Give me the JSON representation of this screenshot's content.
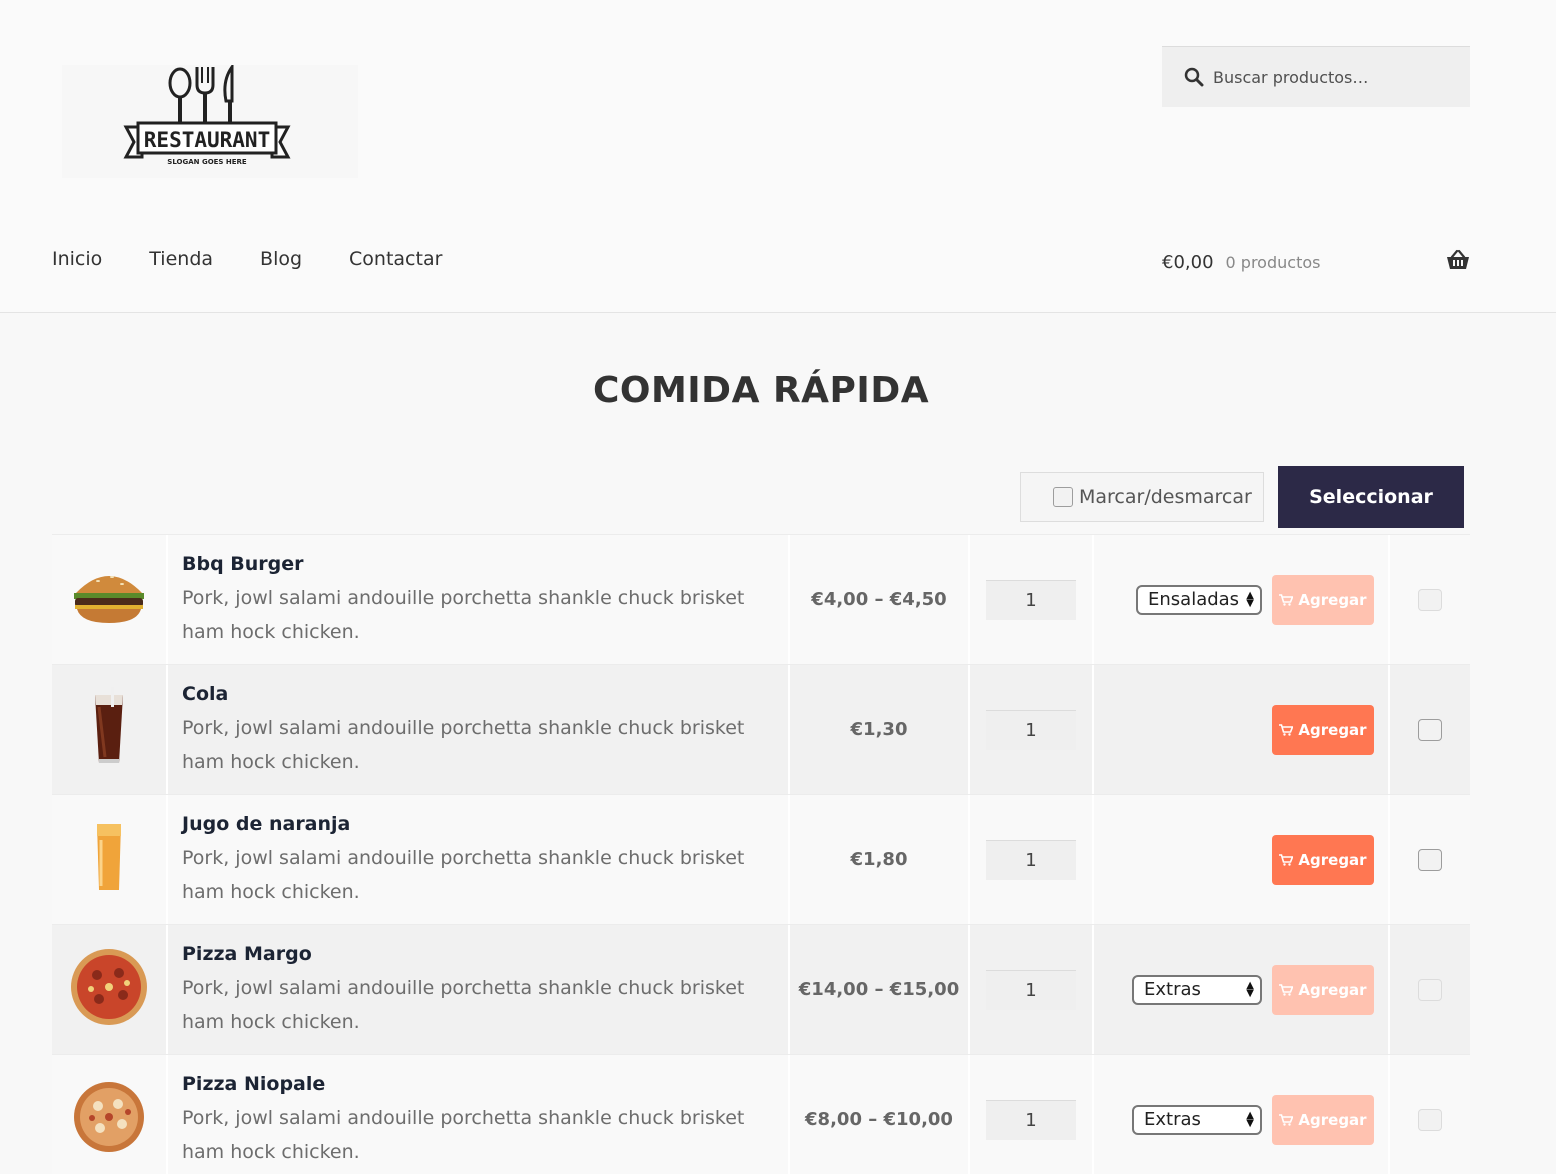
{
  "header": {
    "logo_text": "RESTAURANT",
    "logo_slogan": "SLOGAN GOES HERE",
    "search_placeholder": "Buscar productos…",
    "nav": [
      "Inicio",
      "Tienda",
      "Blog",
      "Contactar"
    ],
    "cart_total": "€0,00",
    "cart_count": "0 productos"
  },
  "main": {
    "title": "COMIDA RÁPIDA",
    "toggle_all_label": "Marcar/desmarcar",
    "select_label": "Seleccionar",
    "add_label": "Agregar",
    "products": [
      {
        "name": "Bbq Burger",
        "desc": "Pork, jowl salami andouille porchetta shankle chuck brisket ham hock chicken.",
        "price": "€4,00 – €4,50",
        "qty": "1",
        "variant": "Ensaladas",
        "enabled": false,
        "image": "burger"
      },
      {
        "name": "Cola",
        "desc": "Pork, jowl salami andouille porchetta shankle chuck brisket ham hock chicken.",
        "price": "€1,30",
        "qty": "1",
        "variant": "",
        "enabled": true,
        "image": "cola"
      },
      {
        "name": "Jugo de naranja",
        "desc": "Pork, jowl salami andouille porchetta shankle chuck brisket ham hock chicken.",
        "price": "€1,80",
        "qty": "1",
        "variant": "",
        "enabled": true,
        "image": "juice"
      },
      {
        "name": "Pizza Margo",
        "desc": "Pork, jowl salami andouille porchetta shankle chuck brisket ham hock chicken.",
        "price": "€14,00 – €15,00",
        "qty": "1",
        "variant": "Extras",
        "enabled": false,
        "image": "pizza"
      },
      {
        "name": "Pizza Niopale",
        "desc": "Pork, jowl salami andouille porchetta shankle chuck brisket ham hock chicken.",
        "price": "€8,00 – €10,00",
        "qty": "1",
        "variant": "Extras",
        "enabled": false,
        "image": "pizza2"
      }
    ]
  },
  "colors": {
    "accent": "#ff7752",
    "accent_disabled": "#ffc2b0",
    "dark_button": "#2c2947"
  }
}
